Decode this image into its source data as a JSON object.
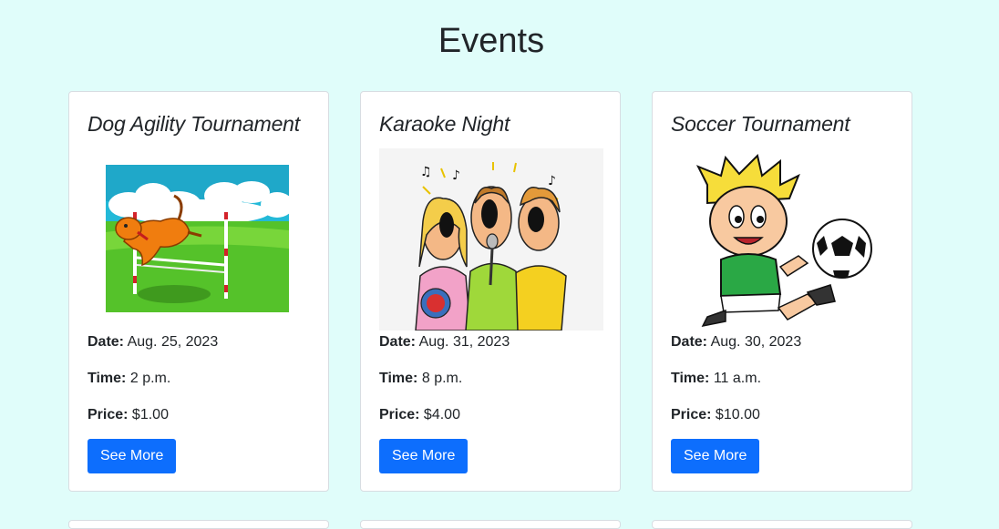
{
  "page": {
    "title": "Events"
  },
  "labels": {
    "date": "Date:",
    "time": "Time:",
    "price": "Price:"
  },
  "events": [
    {
      "title": "Dog Agility Tournament",
      "date": "Aug. 25, 2023",
      "time": "2 p.m.",
      "price": "$1.00",
      "button": "See More",
      "image": "dog-agility-image"
    },
    {
      "title": "Karaoke Night",
      "date": "Aug. 31, 2023",
      "time": "8 p.m.",
      "price": "$4.00",
      "button": "See More",
      "image": "karaoke-image"
    },
    {
      "title": "Soccer Tournament",
      "date": "Aug. 30, 2023",
      "time": "11 a.m.",
      "price": "$10.00",
      "button": "See More",
      "image": "soccer-image"
    }
  ],
  "colors": {
    "background": "#e0fdfa",
    "button": "#0d6efd",
    "card": "#ffffff"
  }
}
